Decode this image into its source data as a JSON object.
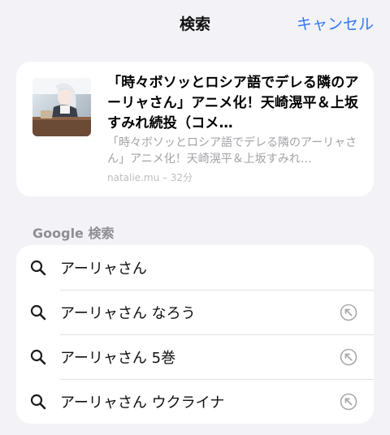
{
  "header": {
    "title": "検索",
    "cancel_label": "キャンセル"
  },
  "article": {
    "title": "「時々ボソッとロシア語でデレる隣のアーリャさん」アニメ化！天崎滉平＆上坂すみれ続投（コメ…",
    "description": "「時々ボソッとロシア語でデレる隣のアーリャさん」アニメ化！天崎滉平＆上坂すみれ…",
    "meta": "natalie.mu – 32分"
  },
  "google": {
    "section_label": "Google 検索",
    "suggestions": [
      {
        "text": "アーリャさん",
        "icon": "search-icon",
        "fill_icon": ""
      },
      {
        "text": "アーリャさん なろう",
        "icon": "search-icon",
        "fill_icon": "arrow-up-left-icon"
      },
      {
        "text": "アーリャさん 5巻",
        "icon": "search-icon",
        "fill_icon": "arrow-up-left-icon"
      },
      {
        "text": "アーリャさん ウクライナ",
        "icon": "search-icon",
        "fill_icon": "arrow-up-left-icon"
      }
    ]
  },
  "colors": {
    "accent": "#3478f6",
    "background": "#f2f2f7",
    "secondary_text": "#8e8e93"
  }
}
